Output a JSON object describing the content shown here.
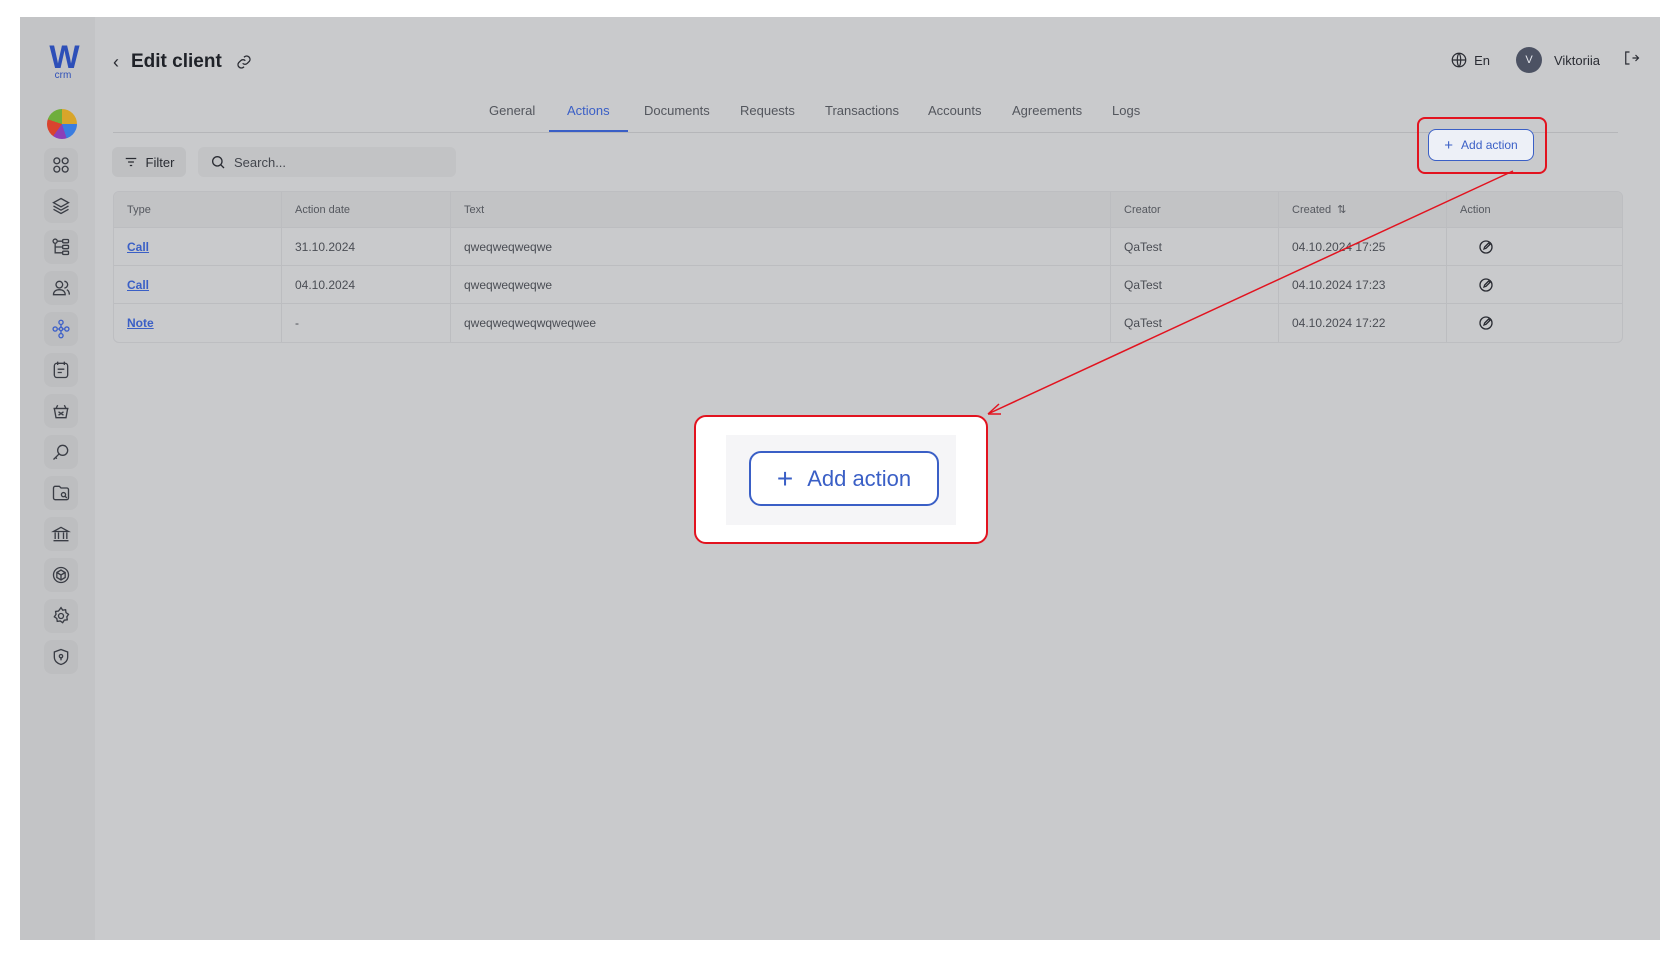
{
  "sidebar": {
    "logo": {
      "mark": "W",
      "sub": "crm"
    },
    "items": [
      {
        "icon": "grid-icon"
      },
      {
        "icon": "layers-icon"
      },
      {
        "icon": "hierarchy-icon"
      },
      {
        "icon": "users-icon"
      },
      {
        "icon": "clients-network-icon",
        "active": true
      },
      {
        "icon": "notes-icon"
      },
      {
        "icon": "basket-icon"
      },
      {
        "icon": "key-search-icon"
      },
      {
        "icon": "folder-icon"
      },
      {
        "icon": "bank-icon"
      },
      {
        "icon": "box-icon"
      },
      {
        "icon": "settings-icon"
      },
      {
        "icon": "shield-icon"
      }
    ]
  },
  "header": {
    "title": "Edit client",
    "language": "En",
    "user_initial": "V",
    "user_name": "Viktoriia"
  },
  "tabs": [
    {
      "label": "General"
    },
    {
      "label": "Actions",
      "active": true
    },
    {
      "label": "Documents"
    },
    {
      "label": "Requests"
    },
    {
      "label": "Transactions"
    },
    {
      "label": "Accounts"
    },
    {
      "label": "Agreements"
    },
    {
      "label": "Logs"
    }
  ],
  "toolbar": {
    "filter_label": "Filter",
    "search_placeholder": "Search...",
    "add_action_label": "Add action"
  },
  "table": {
    "columns": [
      "Type",
      "Action date",
      "Text",
      "Creator",
      "Created",
      "Action"
    ],
    "rows": [
      {
        "type": "Call",
        "action_date": "31.10.2024",
        "text": "qweqweqweqwe",
        "creator": "QaTest",
        "created": "04.10.2024 17:25"
      },
      {
        "type": "Call",
        "action_date": "04.10.2024",
        "text": "qweqweqweqwe",
        "creator": "QaTest",
        "created": "04.10.2024 17:23"
      },
      {
        "type": "Note",
        "action_date": "-",
        "text": "qweqweqweqwqweqwee",
        "creator": "QaTest",
        "created": "04.10.2024 17:22"
      }
    ]
  },
  "callout": {
    "label": "Add action"
  },
  "colors": {
    "accent": "#3a5fc6",
    "highlight": "#e2131f",
    "overlay": "#c9cacc"
  }
}
